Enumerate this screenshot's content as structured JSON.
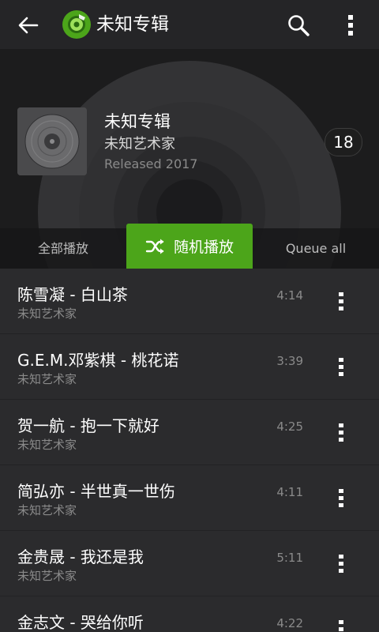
{
  "topbar": {
    "title": "未知专辑",
    "back_icon": "arrow-left-icon",
    "logo_icon": "music-disc-logo-icon",
    "search_icon": "search-icon",
    "menu_icon": "more-vertical-icon"
  },
  "album": {
    "title": "未知专辑",
    "artist": "未知艺术家",
    "released": "Released 2017",
    "track_count": "18",
    "cover_icon": "vinyl-disc-icon"
  },
  "actions": {
    "play_all": "全部播放",
    "shuffle": "随机播放",
    "shuffle_icon": "shuffle-icon",
    "queue_all": "Queue all"
  },
  "songs": [
    {
      "title": "陈雪凝 - 白山茶",
      "artist": "未知艺术家",
      "duration": "4:14"
    },
    {
      "title": "G.E.M.邓紫棋 - 桃花诺",
      "artist": "未知艺术家",
      "duration": "3:39"
    },
    {
      "title": "贺一航 - 抱一下就好",
      "artist": "未知艺术家",
      "duration": "4:25"
    },
    {
      "title": "简弘亦 - 半世真一世伤",
      "artist": "未知艺术家",
      "duration": "4:11"
    },
    {
      "title": "金贵晟 - 我还是我",
      "artist": "未知艺术家",
      "duration": "5:11"
    },
    {
      "title": "金志文 - 哭给你听",
      "artist": "",
      "duration": "4:22"
    }
  ],
  "colors": {
    "accent": "#4ca51a",
    "background": "#2b2b2d",
    "header_bg": "#1c1c1d",
    "secondary_text": "#8a8a8a"
  }
}
